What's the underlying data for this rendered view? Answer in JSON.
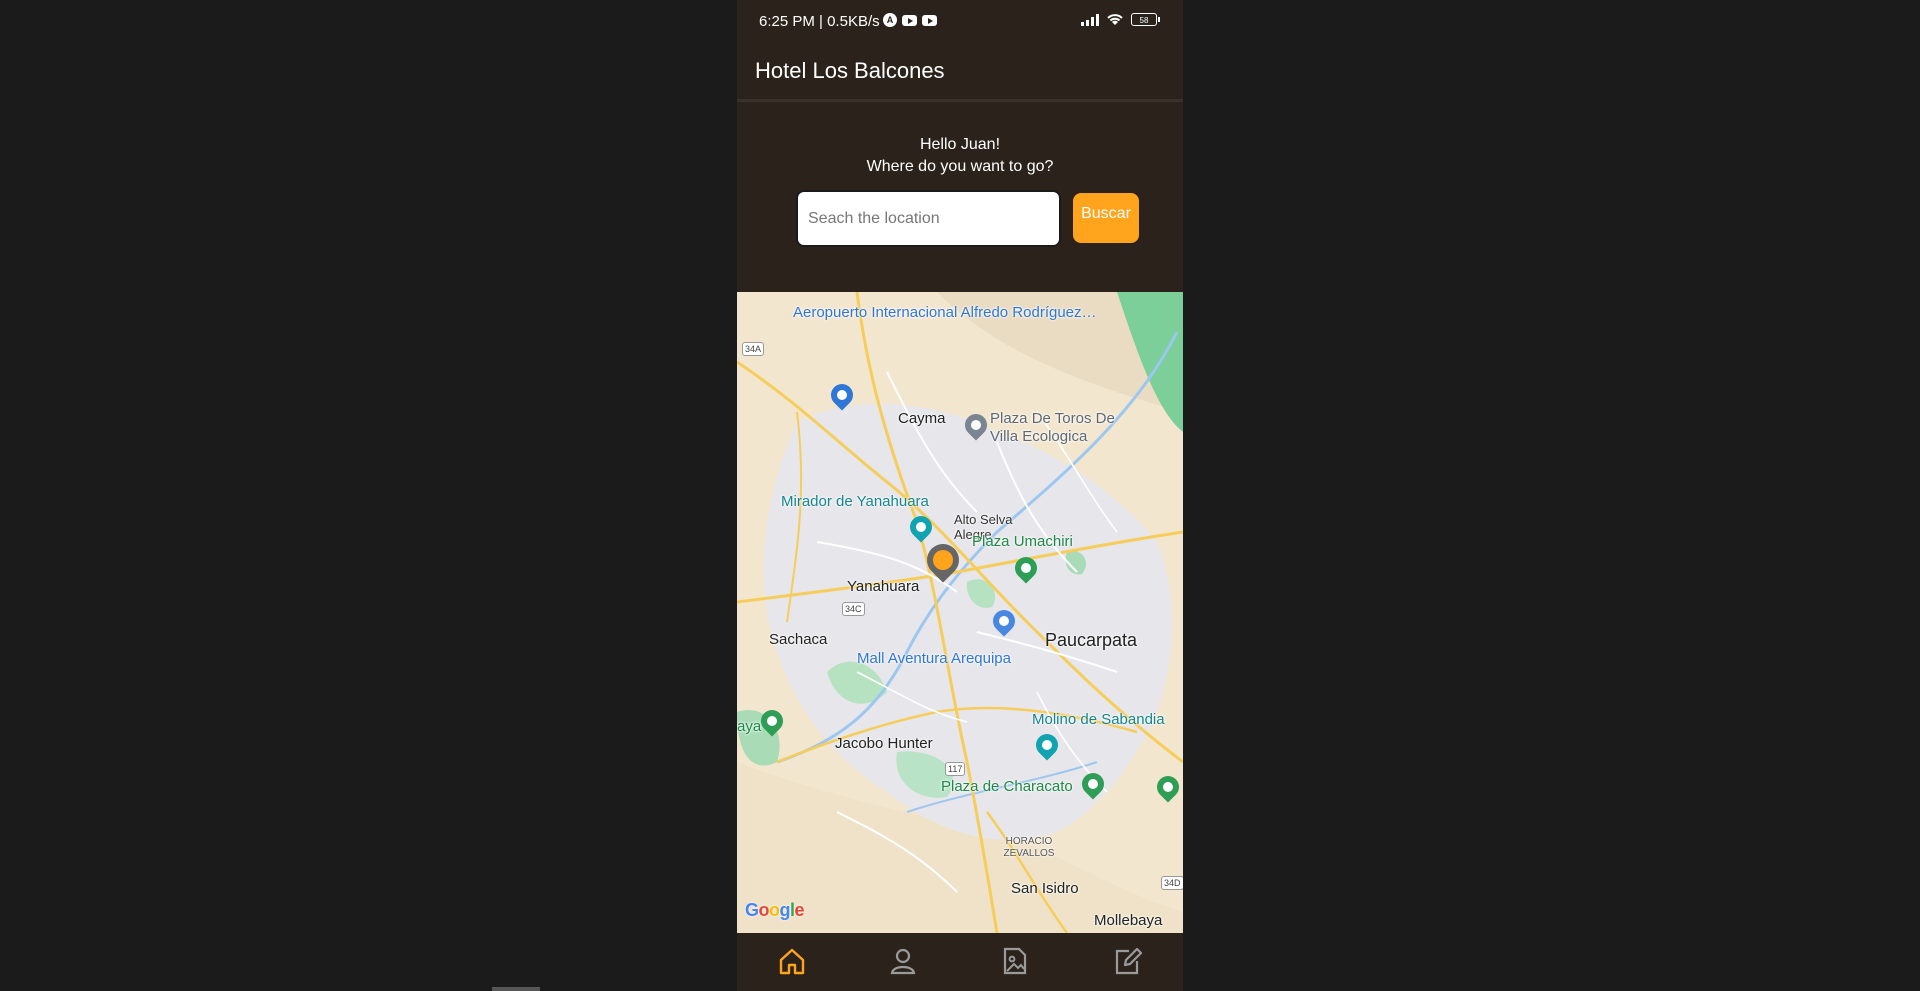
{
  "status_bar": {
    "time": "6:25 PM | 0.5KB/s",
    "battery": "58"
  },
  "app_bar": {
    "title": "Hotel Los Balcones"
  },
  "greeting": {
    "line1": "Hello Juan!",
    "line2": "Where do you want to go?"
  },
  "search": {
    "placeholder": "Seach the location",
    "value": "",
    "button_label": "Buscar"
  },
  "map": {
    "labels": {
      "airport": "Aeropuerto Internacional Alfredo Rodríguez…",
      "cayma": "Cayma",
      "plaza_toros": "Plaza De Toros De Villa Ecologica",
      "mirador": "Mirador de Yanahuara",
      "alto_selva": "Alto Selva Alegre",
      "plaza_umachiri": "Plaza Umachiri",
      "yanahuara": "Yanahuara",
      "sachaca": "Sachaca",
      "paucarpata": "Paucarpata",
      "mall": "Mall Aventura Arequipa",
      "molino": "Molino de Sabandia",
      "jacobo": "Jacobo Hunter",
      "plaza_characato": "Plaza de Characato",
      "horacio": "HORACIO ZEVALLOS",
      "san_isidro": "San Isidro",
      "mollebaya": "Mollebaya",
      "edge_left": "aya"
    },
    "road_shields": [
      "34A",
      "34C",
      "117",
      "34D"
    ],
    "attribution": "Google",
    "accent_color": "#ffa41c"
  },
  "bottom_nav": {
    "items": [
      "home-icon",
      "profile-icon",
      "gallery-icon",
      "edit-icon"
    ],
    "active": "home-icon"
  }
}
